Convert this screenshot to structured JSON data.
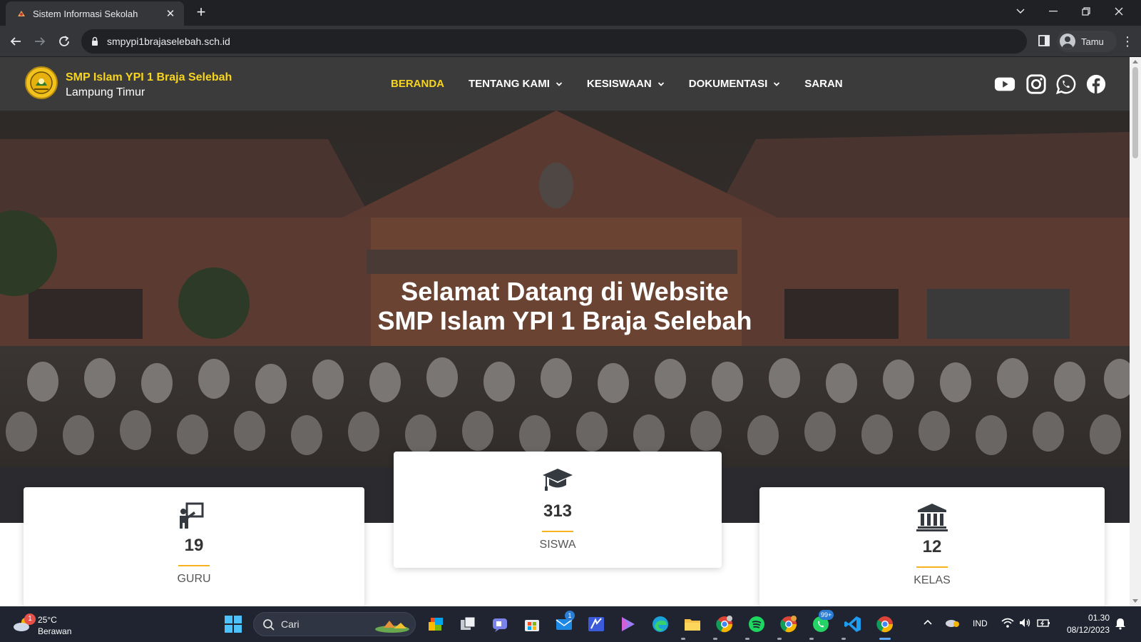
{
  "browser": {
    "tab_title": "Sistem Informasi Sekolah",
    "tab_close": "✕",
    "new_tab": "+",
    "url": "smpypi1brajaselebah.sch.id",
    "profile_label": "Tamu",
    "menu_glyph": "⋮",
    "window_controls": {
      "dropdown": "⌄",
      "minimize": "—",
      "restore": "❐",
      "close": "✕"
    }
  },
  "site": {
    "brand_name": "SMP Islam YPI 1 Braja Selebah",
    "brand_sub": "Lampung Timur",
    "nav": [
      {
        "label": "BERANDA",
        "active": true,
        "dropdown": false
      },
      {
        "label": "TENTANG KAMI",
        "active": false,
        "dropdown": true
      },
      {
        "label": "KESISWAAN",
        "active": false,
        "dropdown": true
      },
      {
        "label": "DOKUMENTASI",
        "active": false,
        "dropdown": true
      },
      {
        "label": "SARAN",
        "active": false,
        "dropdown": false
      }
    ],
    "social_icons": [
      "youtube-icon",
      "instagram-icon",
      "whatsapp-icon",
      "facebook-icon"
    ],
    "colors": {
      "header_bg": "#3b3b3b",
      "accent": "#f6d41f",
      "divider": "#f6b21f"
    }
  },
  "hero": {
    "title_line1": "Selamat Datang di Website",
    "title_line2": "SMP Islam YPI 1 Braja Selebah"
  },
  "stats": [
    {
      "icon": "teacher-icon",
      "value": "19",
      "label": "GURU"
    },
    {
      "icon": "graduation-cap-icon",
      "value": "313",
      "label": "SISWA"
    },
    {
      "icon": "building-icon",
      "value": "12",
      "label": "KELAS"
    }
  ],
  "taskbar": {
    "weather_temp": "25°C",
    "weather_cond": "Berawan",
    "weather_badge": "1",
    "search_placeholder": "Cari",
    "mail_badge": "1",
    "whatsapp_badge": "99+",
    "language": "IND",
    "time": "01.30",
    "date": "08/12/2023"
  }
}
